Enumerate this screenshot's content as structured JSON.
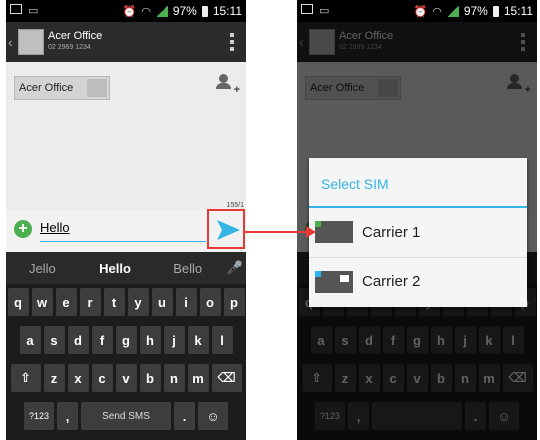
{
  "status_bar": {
    "battery": "97%",
    "time": "15:11"
  },
  "conversation": {
    "contact_name": "Acer Office",
    "contact_number": "02 2969 1234",
    "recipient_chip": "Acer Office",
    "char_counter": "155/1",
    "message_text": "Hello"
  },
  "keyboard": {
    "suggestions": [
      "Jello",
      "Hello",
      "Bello"
    ],
    "row1": [
      "q",
      "w",
      "e",
      "r",
      "t",
      "y",
      "u",
      "i",
      "o",
      "p"
    ],
    "row2": [
      "a",
      "s",
      "d",
      "f",
      "g",
      "h",
      "j",
      "k",
      "l"
    ],
    "row3": [
      "z",
      "x",
      "c",
      "v",
      "b",
      "n",
      "m"
    ],
    "symbols_key": "?123",
    "comma_key": ",",
    "space_label": "Send SMS",
    "period_key": ".",
    "shift_glyph": "⇧",
    "delete_glyph": "⌫",
    "emoji_glyph": "☺",
    "mic_glyph": "🎤"
  },
  "sim_dialog": {
    "title": "Select SIM",
    "options": [
      {
        "label": "Carrier 1",
        "corner_color": "#4caf50"
      },
      {
        "label": "Carrier 2",
        "corner_color": "#29b6f6"
      }
    ]
  },
  "colors": {
    "accent": "#33b5e5",
    "highlight": "#e53935",
    "add_button": "#4caf50"
  },
  "icons": [
    "gallery-icon",
    "voicemail-icon",
    "alarm-icon",
    "wifi-icon",
    "signal-icon",
    "battery-icon",
    "add-contact-icon",
    "attach-plus-icon",
    "send-icon",
    "overflow-menu-icon",
    "mic-icon",
    "shift-icon",
    "delete-icon",
    "emoji-icon"
  ]
}
